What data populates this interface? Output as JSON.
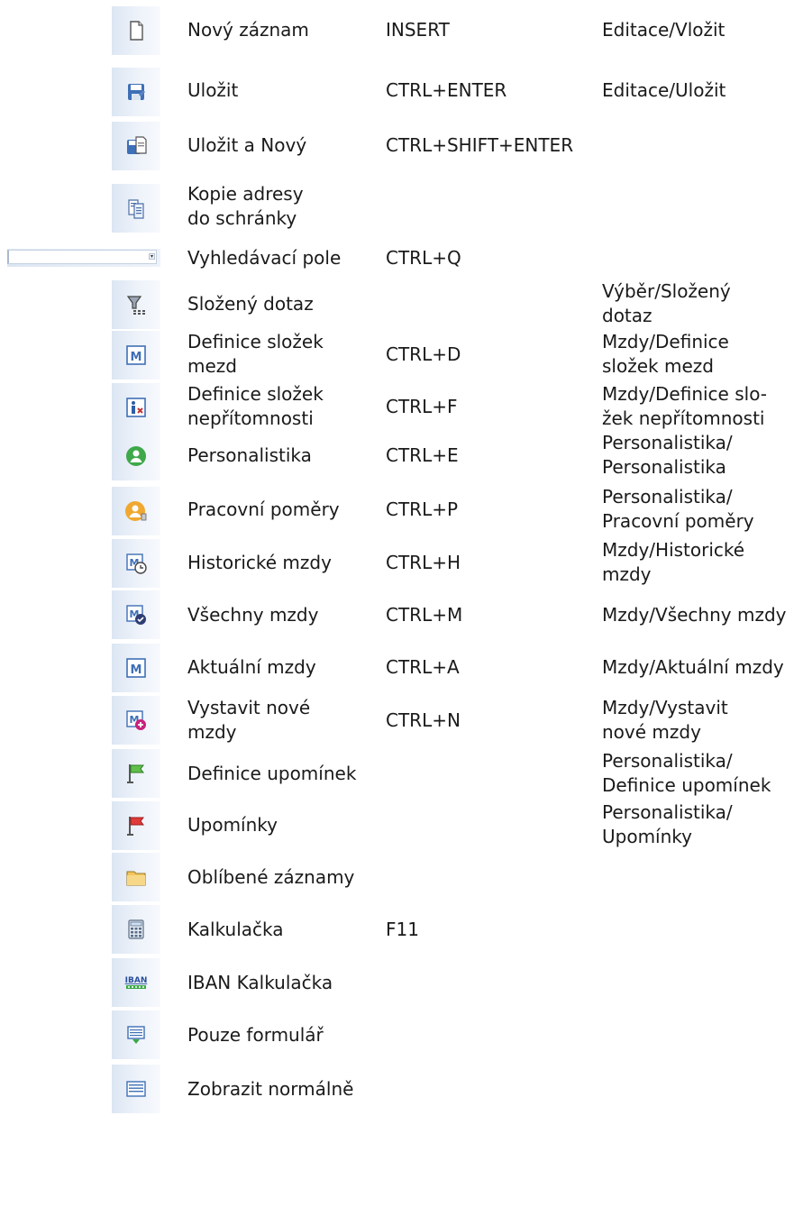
{
  "rows": [
    {
      "icon": "new-record-icon",
      "name": "Nový záznam",
      "shortcut": "INSERT",
      "menu": "Editace/Vložit"
    },
    {
      "icon": "save-icon",
      "name": "Uložit",
      "shortcut": "CTRL+ENTER",
      "menu": "Editace/Uložit"
    },
    {
      "icon": "save-and-new-icon",
      "name": "Uložit a Nový",
      "shortcut": "CTRL+SHIFT+ENTER",
      "menu": ""
    },
    {
      "icon": "copy-address-icon",
      "name": "Kopie adresy\ndo schránky",
      "shortcut": "",
      "menu": ""
    },
    {
      "icon": "search-field-combo",
      "name": "Vyhledávací pole",
      "shortcut": "CTRL+Q",
      "menu": ""
    },
    {
      "icon": "compound-query-filter-icon",
      "name": "Složený dotaz",
      "shortcut": "",
      "menu": "Výběr/Složený\ndotaz"
    },
    {
      "icon": "payroll-components-m-icon",
      "name": "Definice složek\nmezd",
      "shortcut": "CTRL+D",
      "menu": "Mzdy/Definice\nsložek mezd"
    },
    {
      "icon": "absence-components-icon",
      "name": "Definice složek\nnepřítomnosti",
      "shortcut": "CTRL+F",
      "menu": "Mzdy/Definice slo-\nžek nepřítomnosti"
    },
    {
      "icon": "personnel-icon",
      "name": "Personalistika",
      "shortcut": "CTRL+E",
      "menu": "Personalistika/\nPersonalistika"
    },
    {
      "icon": "employment-relations-icon",
      "name": "Pracovní poměry",
      "shortcut": "CTRL+P",
      "menu": "Personalistika/\nPracovní poměry"
    },
    {
      "icon": "historical-payroll-icon",
      "name": "Historické mzdy",
      "shortcut": "CTRL+H",
      "menu": "Mzdy/Historické\nmzdy"
    },
    {
      "icon": "all-payroll-icon",
      "name": "Všechny mzdy",
      "shortcut": "CTRL+M",
      "menu": "Mzdy/Všechny mzdy"
    },
    {
      "icon": "current-payroll-icon",
      "name": "Aktuální mzdy",
      "shortcut": "CTRL+A",
      "menu": "Mzdy/Aktuální mzdy"
    },
    {
      "icon": "new-payroll-icon",
      "name": "Vystavit nové\nmzdy",
      "shortcut": "CTRL+N",
      "menu": "Mzdy/Vystavit\nnové mzdy"
    },
    {
      "icon": "reminder-definition-green-flag-icon",
      "name": "Definice upomínek",
      "shortcut": "",
      "menu": "Personalistika/\nDefinice upomínek"
    },
    {
      "icon": "reminders-red-flag-icon",
      "name": "Upomínky",
      "shortcut": "",
      "menu": "Personalistika/\nUpomínky"
    },
    {
      "icon": "favorite-records-folder-icon",
      "name": "Oblíbené záznamy",
      "shortcut": "",
      "menu": ""
    },
    {
      "icon": "calculator-icon",
      "name": "Kalkulačka",
      "shortcut": "F11",
      "menu": ""
    },
    {
      "icon": "iban-calculator-icon",
      "name": "IBAN Kalkulačka",
      "shortcut": "",
      "menu": ""
    },
    {
      "icon": "form-only-icon",
      "name": "Pouze formulář",
      "shortcut": "",
      "menu": ""
    },
    {
      "icon": "normal-view-icon",
      "name": "Zobrazit normálně",
      "shortcut": "",
      "menu": ""
    }
  ]
}
